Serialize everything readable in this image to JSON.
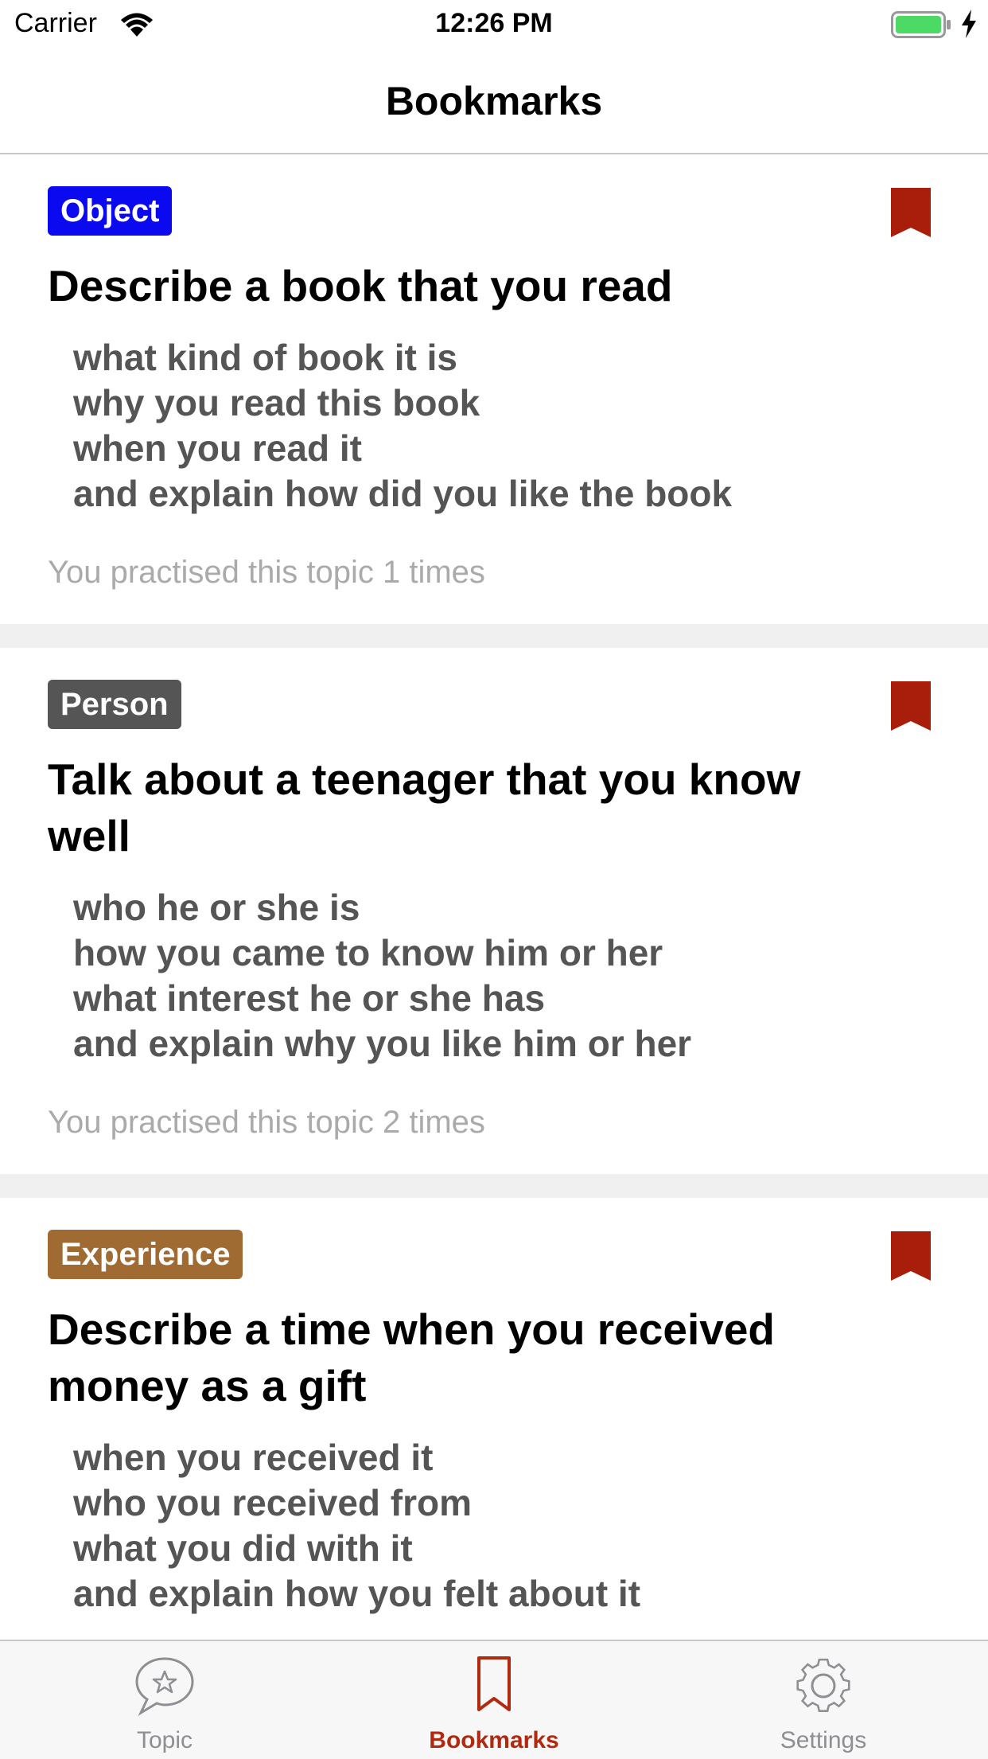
{
  "status_bar": {
    "carrier": "Carrier",
    "time": "12:26 PM"
  },
  "nav": {
    "title": "Bookmarks"
  },
  "colors": {
    "accent": "#b12a0f",
    "bookmark": "#a81e0b",
    "tag_object": "#0a09f0",
    "tag_person": "#555555",
    "tag_experience": "#a06a33"
  },
  "cards": [
    {
      "tag": "Object",
      "title": "Describe a book that you read",
      "prompts": [
        "what kind of book it is",
        "why you read this book",
        "when you read it",
        "and explain how did you like the book"
      ],
      "practised": "You practised this topic 1 times"
    },
    {
      "tag": "Person",
      "title": "Talk about a teenager that you know well",
      "prompts": [
        "who he or she is",
        "how you came to know him or her",
        "what interest he or she has",
        "and explain why you like him or her"
      ],
      "practised": "You practised this topic 2 times"
    },
    {
      "tag": "Experience",
      "title": "Describe a time when you received money as a gift",
      "prompts": [
        "when you received it",
        "who you received from",
        "what you did with it",
        "and explain how you felt about it"
      ]
    }
  ],
  "tabs": [
    {
      "label": "Topic",
      "icon": "chat-star-icon"
    },
    {
      "label": "Bookmarks",
      "icon": "bookmark-icon"
    },
    {
      "label": "Settings",
      "icon": "gear-icon"
    }
  ]
}
